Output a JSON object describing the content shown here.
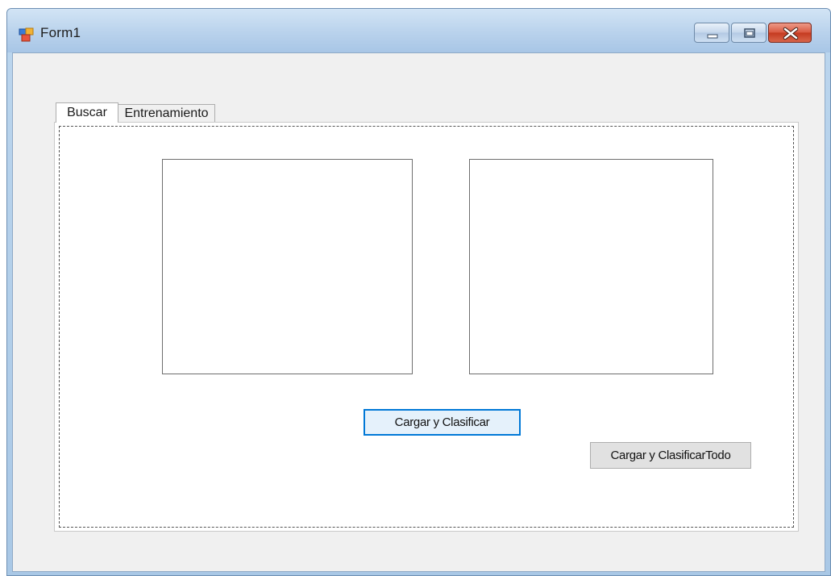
{
  "window": {
    "title": "Form1",
    "icon": "form-icon",
    "controls": {
      "minimize_icon": "minimize-icon",
      "maximize_icon": "maximize-icon",
      "close_icon": "close-icon"
    },
    "colors": {
      "close_button": "#c9472f",
      "focus_border": "#0078d7",
      "client_background": "#f0f0f0"
    }
  },
  "tabs": [
    {
      "label": "Buscar",
      "selected": true
    },
    {
      "label": "Entrenamiento",
      "selected": false
    }
  ],
  "buscar_page": {
    "buttons": {
      "load_classify": "Cargar y Clasificar",
      "load_classify_all": "Cargar y ClasificarTodo"
    }
  }
}
